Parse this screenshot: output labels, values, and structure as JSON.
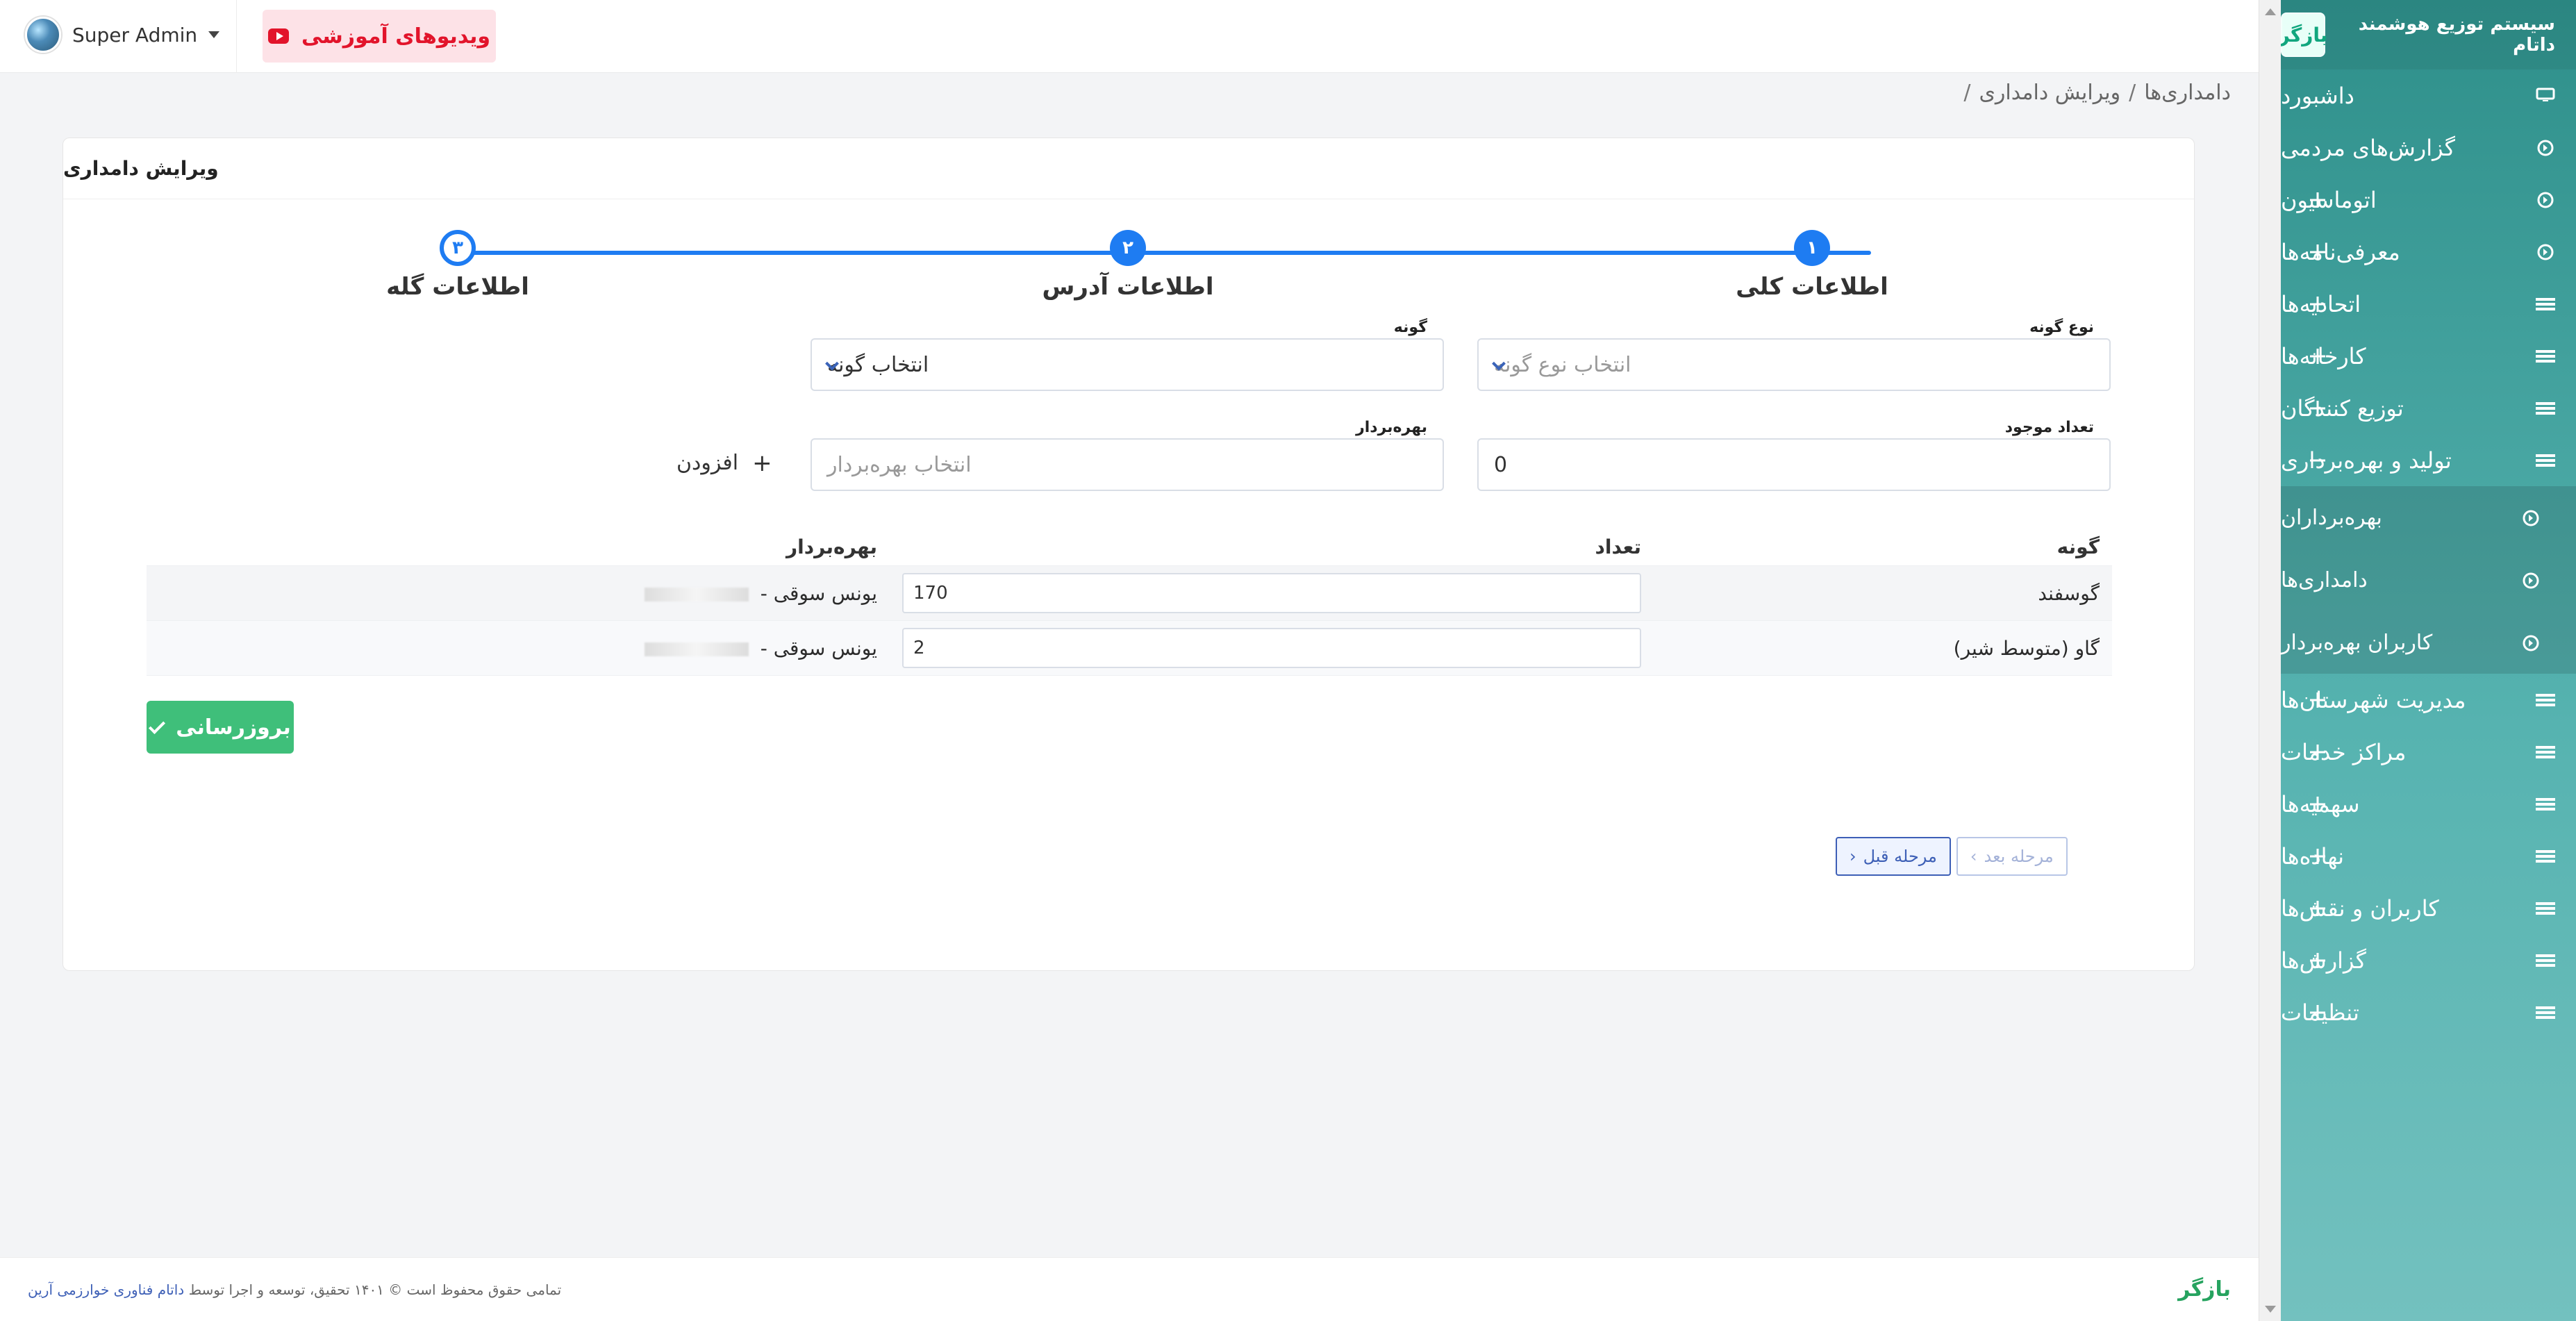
{
  "app": {
    "brand_text": "سیستم توزیع هوشمند داتام",
    "brand_logo": "بازگر"
  },
  "topbar": {
    "user_name": "Super Admin",
    "videos_label": "ویدیوهای آموزشی"
  },
  "breadcrumb": {
    "item1": "دامداری‌ها",
    "item2": "ویرایش دامداری",
    "sep": "/"
  },
  "card": {
    "title": "ویرایش دامداری"
  },
  "stepper": {
    "steps": [
      {
        "num": "۱",
        "title": "اطلاعات کلی"
      },
      {
        "num": "۲",
        "title": "اطلاعات آدرس"
      },
      {
        "num": "۳",
        "title": "اطلاعات گله"
      }
    ]
  },
  "form": {
    "species_type": {
      "label": "نوع گونه",
      "placeholder": "انتخاب نوع گونه"
    },
    "species": {
      "label": "گونه",
      "value": "انتخاب گونه"
    },
    "count": {
      "label": "تعداد موجود",
      "value": "0"
    },
    "owner": {
      "label": "بهره‌بردار",
      "placeholder": "انتخاب بهره‌بردار"
    },
    "add_label": "افزودن"
  },
  "table": {
    "headers": {
      "species": "گونه",
      "count": "تعداد",
      "owner": "بهره‌بردار"
    },
    "rows": [
      {
        "species": "گوسفند",
        "count": "170",
        "owner": "یونس سوقی -"
      },
      {
        "species": "گاو (متوسط شیر)",
        "count": "2",
        "owner": "یونس سوقی -"
      }
    ]
  },
  "actions": {
    "update_label": "بروزرسانی",
    "prev_label": "مرحله قبل",
    "next_label": "مرحله بعد"
  },
  "sidebar": {
    "items": [
      {
        "label": "داشبورد"
      },
      {
        "label": "گزارش‌های مردمی"
      },
      {
        "label": "اتوماسیون"
      },
      {
        "label": "معرفی‌نامه‌ها"
      },
      {
        "label": "اتحادیه‌ها"
      },
      {
        "label": "کارخانه‌ها"
      },
      {
        "label": "توزیع کنندگان"
      },
      {
        "label": "تولید و بهره‌برداری"
      },
      {
        "label": "مدیریت شهرستان‌ها"
      },
      {
        "label": "مراکز خدمات"
      },
      {
        "label": "سهمیه‌ها"
      },
      {
        "label": "نهاده‌ها"
      },
      {
        "label": "کاربران و نقش‌ها"
      },
      {
        "label": "گزارش‌ها"
      },
      {
        "label": "تنظیمات"
      }
    ],
    "subitems": [
      {
        "label": "بهره‌برداران"
      },
      {
        "label": "دامداری‌ها"
      },
      {
        "label": "کاربران بهره‌بردار"
      }
    ]
  },
  "footer": {
    "text": "تمامی حقوق محفوظ است © ۱۴۰۱ تحقیق، توسعه و اجرا توسط",
    "link": "داتام فناوری خوارزمی آرین",
    "logo": "بازگر"
  },
  "colors": {
    "sidebar": "#2f8f8a",
    "accent_blue": "#1e7cf2",
    "success": "#3fbf7a",
    "danger": "#e2142b"
  },
  "icons": {
    "dashboard": "monitor-icon",
    "circle": "circle-arrow-icon",
    "list": "list-icon",
    "plus": "plus-icon",
    "minus": "minus-icon",
    "youtube": "youtube-icon",
    "chevron": "chevron-down-icon",
    "check": "check-icon"
  }
}
